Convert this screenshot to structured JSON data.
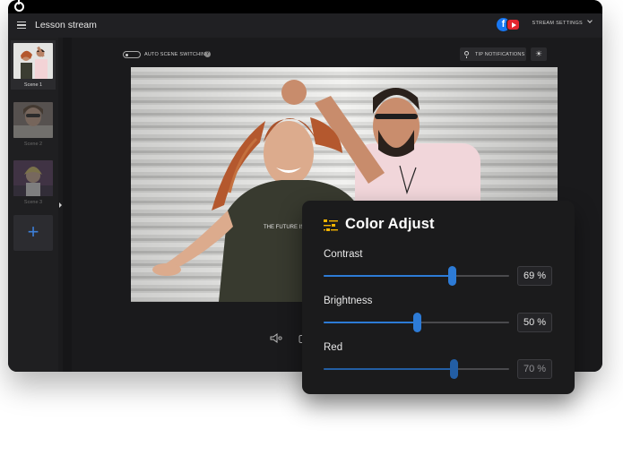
{
  "window": {
    "title": "Lesson stream"
  },
  "header": {
    "social_facebook": "f",
    "stream_settings_label": "STREAM SETTINGS"
  },
  "sidebar": {
    "scenes": [
      {
        "label": "Scene 1",
        "active": true
      },
      {
        "label": "Scene 2",
        "active": false
      },
      {
        "label": "Scene 3",
        "active": false
      }
    ],
    "add_scene": "+"
  },
  "toolbar": {
    "auto_scene_switching_label": "AUTO SCENE SWITCHING",
    "auto_scene_switching_on": false,
    "help_icon": "?",
    "tip_notifications_label": "TIP NOTIFICATIONS",
    "brightness_icon": "☀"
  },
  "preview": {
    "shirt_text": "THE FUTURE IS BRIGHT"
  },
  "color_adjust": {
    "title": "Color Adjust",
    "controls": [
      {
        "label": "Contrast",
        "value": 69,
        "display": "69 %",
        "enabled": true
      },
      {
        "label": "Brightness",
        "value": 50,
        "display": "50 %",
        "enabled": true
      },
      {
        "label": "Red",
        "value": 70,
        "display": "70 %",
        "enabled": false
      }
    ]
  },
  "colors": {
    "accent": "#2d7bd6",
    "panel_bg": "#1b1b1c",
    "app_bg": "#1b1b1d",
    "icon_yellow": "#f4b400",
    "facebook": "#1877f2",
    "youtube": "#e3262e"
  },
  "icons": [
    "menu-icon",
    "facebook-icon",
    "youtube-icon",
    "chevron-down-icon",
    "help-icon",
    "lightbulb-icon",
    "brightness-icon",
    "plus-icon",
    "speaker-icon",
    "camera-icon",
    "sliders-icon"
  ]
}
